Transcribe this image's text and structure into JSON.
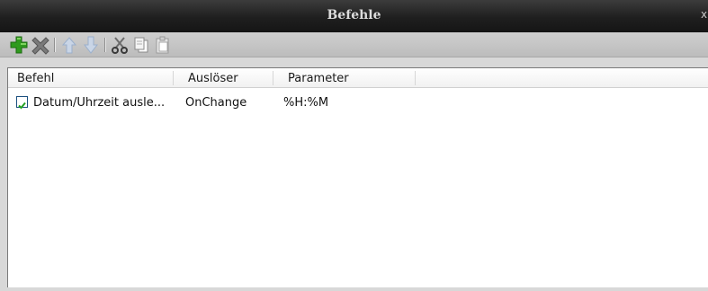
{
  "window": {
    "title": "Befehle",
    "close_glyph": "x"
  },
  "toolbar": {
    "buttons": [
      {
        "icon": "add-icon",
        "color": "#2f9a1e"
      },
      {
        "icon": "delete-icon",
        "color": "#7a7a7a"
      },
      {
        "icon": "arrow-up-icon",
        "color": "#9bb0cc"
      },
      {
        "icon": "arrow-down-icon",
        "color": "#9bb0cc"
      },
      {
        "icon": "cut-icon",
        "color": "#6b6b6b"
      },
      {
        "icon": "copy-icon",
        "color": "#8a8a8a"
      },
      {
        "icon": "paste-icon",
        "color": "#9a9a9a"
      }
    ]
  },
  "table": {
    "columns": [
      "Befehl",
      "Auslöser",
      "Parameter"
    ],
    "rows": [
      {
        "checked": true,
        "befehl": "Datum/Uhrzeit ausle...",
        "ausloeser": "OnChange",
        "parameter": "%H:%M"
      }
    ]
  }
}
